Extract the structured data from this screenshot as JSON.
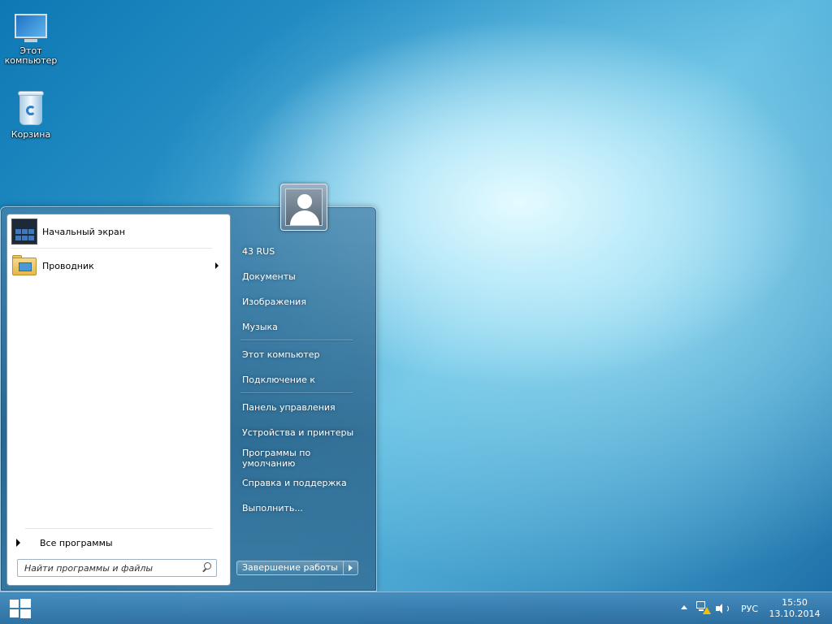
{
  "desktop": {
    "icons": [
      {
        "label": "Этот компьютер",
        "icon": "computer-icon"
      },
      {
        "label": "Корзина",
        "icon": "recycle-bin-icon"
      }
    ]
  },
  "start_menu": {
    "left": {
      "items": [
        {
          "label": "Начальный экран",
          "icon": "start-screen-icon"
        },
        {
          "label": "Проводник",
          "icon": "file-explorer-icon",
          "has_submenu": true
        }
      ],
      "all_programs": "Все программы",
      "search_placeholder": "Найти программы и файлы"
    },
    "right": {
      "user_name": "43 RUS",
      "items": [
        "Документы",
        "Изображения",
        "Музыка",
        "Этот компьютер",
        "Подключение к",
        "Панель управления",
        "Устройства и принтеры",
        "Программы по умолчанию",
        "Справка и поддержка",
        "Выполнить..."
      ]
    },
    "shutdown_label": "Завершение работы"
  },
  "taskbar": {
    "language": "РУС",
    "time": "15:50",
    "date": "13.10.2014"
  }
}
